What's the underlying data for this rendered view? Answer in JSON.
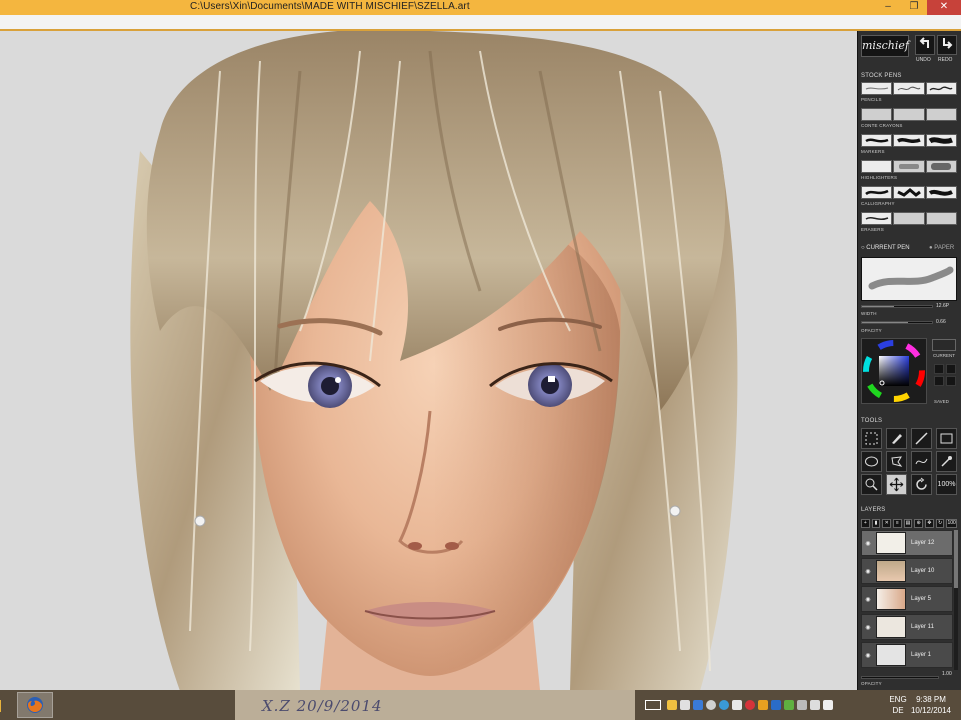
{
  "window": {
    "title": "C:\\Users\\Xin\\Documents\\MADE WITH MISCHIEF\\SZELLA.art",
    "min_glyph": "–",
    "restore_glyph": "❐",
    "close_glyph": "✕"
  },
  "panel": {
    "logo": "mischief",
    "undo_label": "UNDO",
    "redo_label": "REDO",
    "stock_pens_label": "STOCK PENS",
    "pen_categories": [
      "PENCILS",
      "CONTE CRAYONS",
      "MARKERS",
      "HIGHLIGHTERS",
      "CALLIGRAPHY",
      "ERASERS"
    ],
    "current_pen_label": "CURRENT PEN",
    "paper_label": "PAPER",
    "width_label": "WIDTH",
    "width_value": "12.6P",
    "opacity_label": "OPACITY",
    "opacity_value": "0.66",
    "current_label": "CURRENT",
    "saved_label": "SAVED",
    "tools_label": "TOOLS",
    "zoom_tool_label": "100%",
    "layers_label": "LAYERS",
    "layer_zoom_label": "100",
    "layers": [
      {
        "name": "Layer 12",
        "selected": true
      },
      {
        "name": "Layer 10",
        "selected": false
      },
      {
        "name": "Layer 5",
        "selected": false
      },
      {
        "name": "Layer 11",
        "selected": false
      },
      {
        "name": "Layer 1",
        "selected": false
      }
    ],
    "bottom_opacity_label": "OPACITY",
    "bottom_opacity_value": "1.00"
  },
  "taskbar": {
    "signature": "X.Z 20/9/2014",
    "lang_line1": "ENG",
    "lang_line2": "DE",
    "time": "9:38 PM",
    "date": "10/12/2014"
  },
  "colors": {
    "titlebar": "#f4b63f",
    "close": "#c7423a",
    "panel": "#2f2f2f",
    "taskbar": "#584c3c"
  }
}
